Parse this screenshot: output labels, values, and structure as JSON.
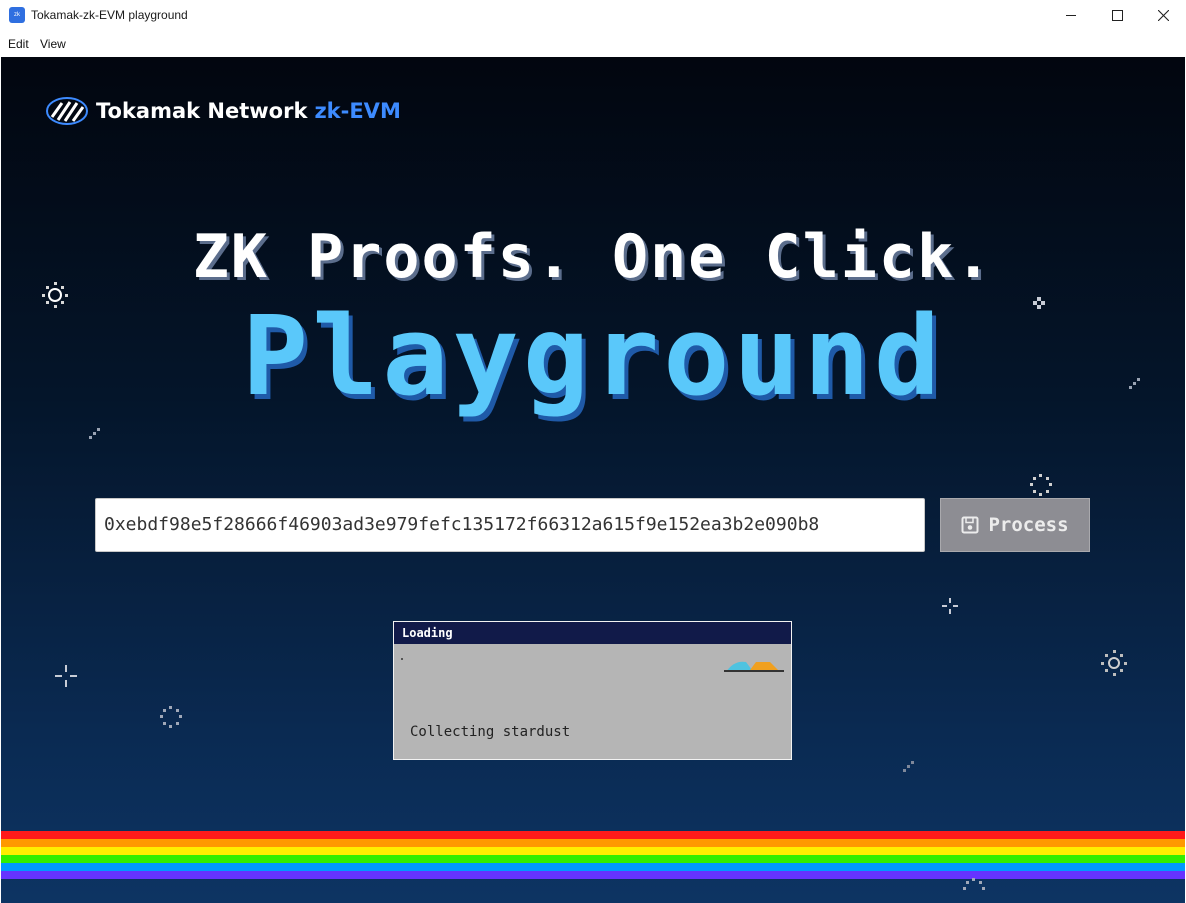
{
  "window": {
    "title": "Tokamak-zk-EVM playground",
    "app_icon": "tokamak-app-icon",
    "controls": [
      "minimize",
      "maximize",
      "close"
    ]
  },
  "menu": {
    "items": [
      {
        "label": "Edit"
      },
      {
        "label": "View"
      }
    ]
  },
  "brand": {
    "name": "Tokamak Network",
    "product": "zk-EVM",
    "accent_color": "#3d8bff"
  },
  "hero": {
    "tagline": "ZK Proofs. One Click.",
    "title": "Playground",
    "title_color": "#5ac8fa"
  },
  "form": {
    "tx_hash_value": "0xebdf98e5f28666f46903ad3e979fefc135172f66312a615f9e152ea3b2e090b8",
    "process_label": "Process",
    "process_icon": "save-icon",
    "process_disabled": true
  },
  "loading_dialog": {
    "title": "Loading",
    "status_text": "Collecting stardust"
  },
  "decor": {
    "rainbow_colors": [
      "#ff1a1a",
      "#ff9900",
      "#ffee00",
      "#33ee00",
      "#0099ff",
      "#6633ff"
    ]
  }
}
